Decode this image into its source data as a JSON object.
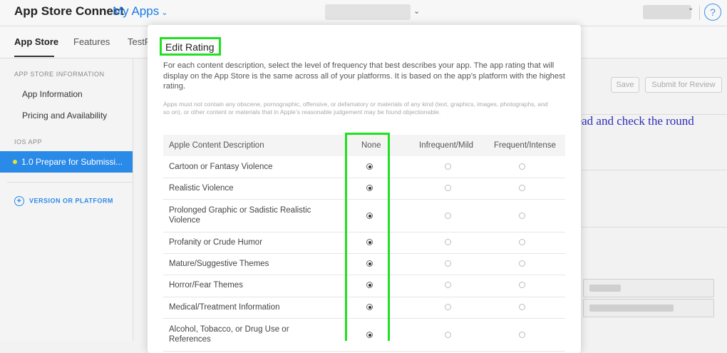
{
  "topbar": {
    "brand": "App Store Connect",
    "app_menu_label": "My Apps",
    "chevron": "⌄",
    "help_label": "?"
  },
  "nav": {
    "tabs": [
      {
        "label": "App Store",
        "active": true
      },
      {
        "label": "Features",
        "active": false
      },
      {
        "label": "TestF",
        "active": false
      }
    ]
  },
  "sidebar": {
    "section_store_info": "APP STORE INFORMATION",
    "items": [
      "App Information",
      "Pricing and Availability"
    ],
    "section_ios": "IOS APP",
    "active_item": "1.0 Prepare for Submissi...",
    "version_link": "VERSION OR PLATFORM",
    "plus_glyph": "+"
  },
  "main": {
    "save_label": "Save",
    "submit_label": "Submit for Review"
  },
  "annotation": "** Read and check the round",
  "modal": {
    "title": "Edit Rating",
    "description": "For each content description, select the level of frequency that best describes your app. The app rating that will display on the App Store is the same across all of your platforms. It is based on the app’s platform with the highest rating.",
    "note": "Apps must not contain any obscene, pornographic, offensive, or defamatory or materials of any kind (text, graphics, images, photographs, and so on), or other content or materials that in Apple’s reasonable judgement may be found objectionable.",
    "columns": [
      "Apple Content Description",
      "None",
      "Infrequent/Mild",
      "Frequent/Intense"
    ],
    "rows": [
      {
        "label": "Cartoon or Fantasy Violence",
        "selected": "None"
      },
      {
        "label": "Realistic Violence",
        "selected": "None"
      },
      {
        "label": "Prolonged Graphic or Sadistic Realistic Violence",
        "selected": "None"
      },
      {
        "label": "Profanity or Crude Humor",
        "selected": "None"
      },
      {
        "label": "Mature/Suggestive Themes",
        "selected": "None"
      },
      {
        "label": "Horror/Fear Themes",
        "selected": "None"
      },
      {
        "label": "Medical/Treatment Information",
        "selected": "None"
      },
      {
        "label": "Alcohol, Tobacco, or Drug Use or References",
        "selected": "None"
      }
    ]
  },
  "colors": {
    "accent": "#1a7ae8",
    "highlight": "#21e021",
    "annotation": "#2e2eb8"
  }
}
